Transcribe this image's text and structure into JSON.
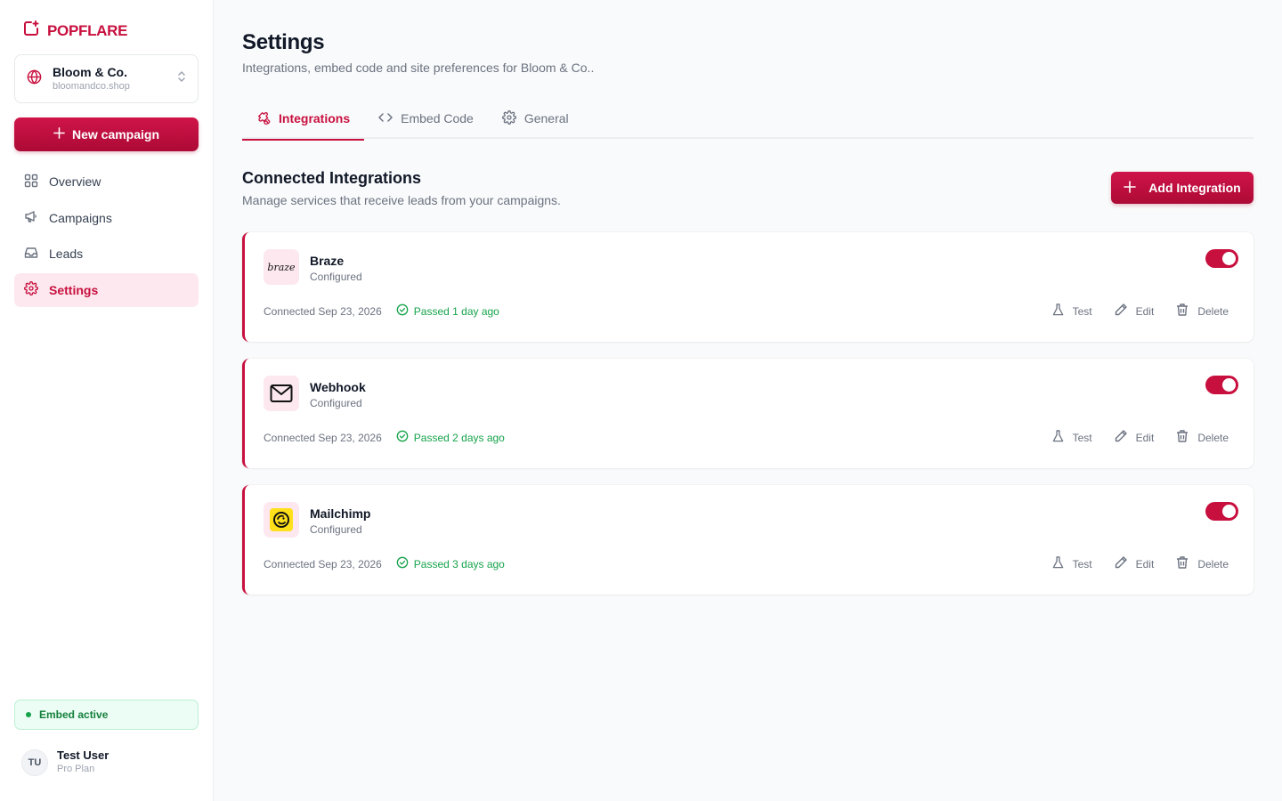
{
  "app": {
    "name": "POPFLARE",
    "brand_color": "#c8103f"
  },
  "site": {
    "name": "Bloom & Co.",
    "url": "bloomandco.shop"
  },
  "sidebar": {
    "new_campaign_label": "New campaign",
    "items": [
      {
        "label": "Overview",
        "icon": "grid-icon",
        "active": false
      },
      {
        "label": "Campaigns",
        "icon": "megaphone-icon",
        "active": false
      },
      {
        "label": "Leads",
        "icon": "inbox-icon",
        "active": false
      },
      {
        "label": "Settings",
        "icon": "gear-icon",
        "active": true
      }
    ],
    "embed_status": "Embed active",
    "user": {
      "initials": "TU",
      "name": "Test User",
      "plan": "Pro Plan"
    }
  },
  "page": {
    "title": "Settings",
    "subtitle": "Integrations, embed code and site preferences for Bloom & Co.."
  },
  "tabs": [
    {
      "label": "Integrations",
      "icon": "puzzle-icon",
      "active": true
    },
    {
      "label": "Embed Code",
      "icon": "code-icon",
      "active": false
    },
    {
      "label": "General",
      "icon": "gear-icon",
      "active": false
    }
  ],
  "section": {
    "title": "Connected Integrations",
    "subtitle": "Manage services that receive leads from your campaigns.",
    "add_label": "Add Integration"
  },
  "integrations": [
    {
      "name": "Braze",
      "status": "Configured",
      "icon": "braze-logo",
      "enabled": true,
      "connected": "Connected Sep 23, 2026",
      "test_result": "Passed 1 day ago"
    },
    {
      "name": "Webhook",
      "status": "Configured",
      "icon": "mail-icon",
      "enabled": true,
      "connected": "Connected Sep 23, 2026",
      "test_result": "Passed 2 days ago"
    },
    {
      "name": "Mailchimp",
      "status": "Configured",
      "icon": "mailchimp-logo",
      "enabled": true,
      "connected": "Connected Sep 23, 2026",
      "test_result": "Passed 3 days ago"
    }
  ],
  "actions": {
    "test_label": "Test",
    "edit_label": "Edit",
    "delete_label": "Delete"
  },
  "braze_logo_text": "braze"
}
